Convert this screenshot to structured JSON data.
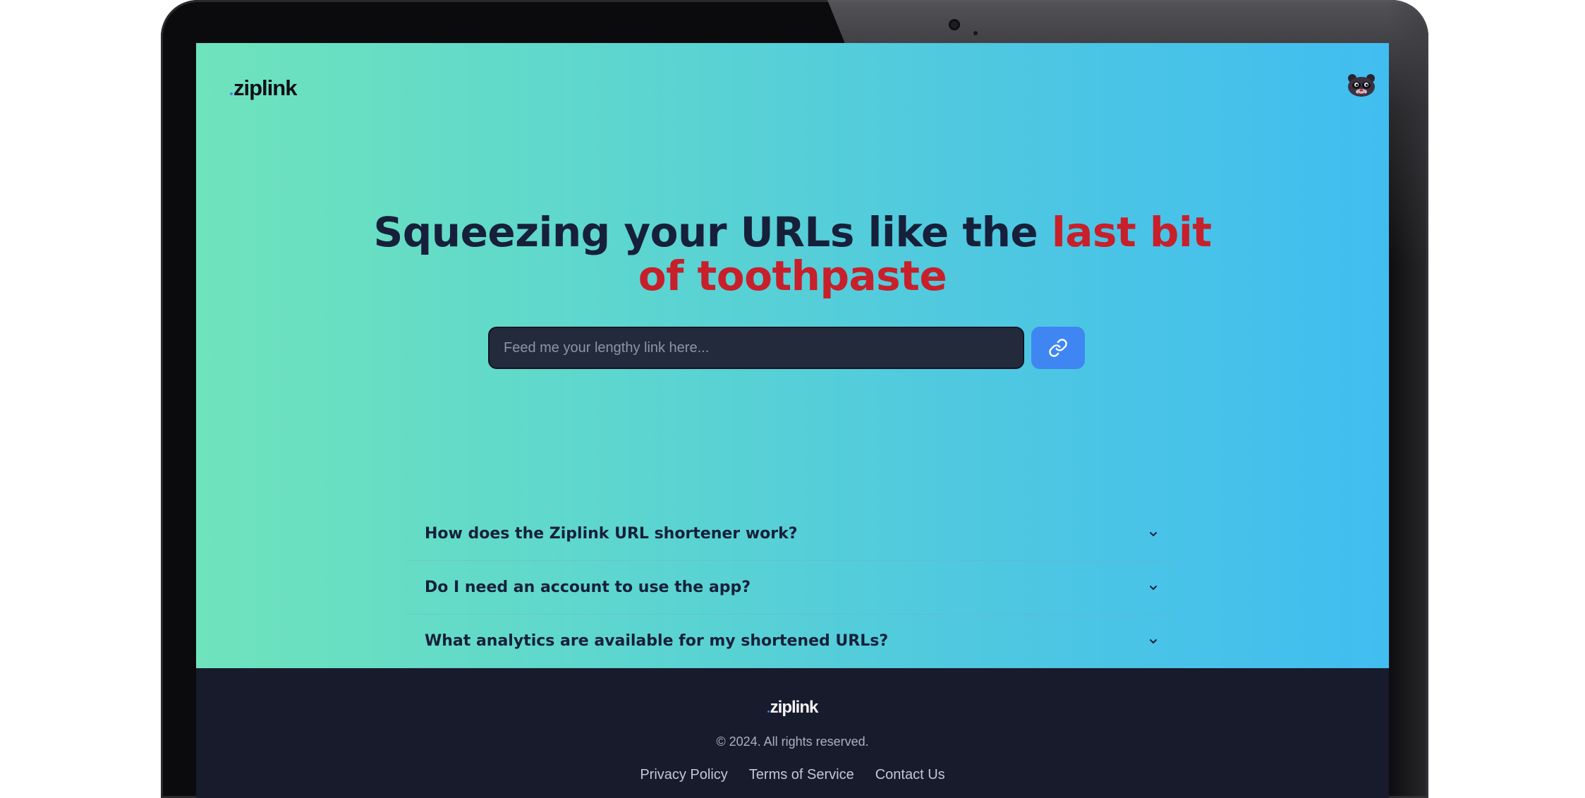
{
  "header": {
    "logo_text": "ziplink",
    "avatar_icon": "raccoon-avatar-icon"
  },
  "hero": {
    "headline_plain": "Squeezing your URLs like the ",
    "headline_accent_line1": "last bit",
    "headline_accent_line2": "of toothpaste",
    "accent_color": "#c7202b"
  },
  "shortener": {
    "input_value": "",
    "placeholder": "Feed me your lengthy link here...",
    "button_icon": "link-icon",
    "button_color": "#3f86f3"
  },
  "faq": {
    "items": [
      {
        "question": "How does the Ziplink URL shortener work?",
        "icon": "chevron-down-icon"
      },
      {
        "question": "Do I need an account to use the app?",
        "icon": "chevron-down-icon"
      },
      {
        "question": "What analytics are available for my shortened URLs?",
        "icon": "chevron-down-icon"
      }
    ]
  },
  "footer": {
    "logo_text": "ziplink",
    "copyright": "© 2024. All rights reserved.",
    "links": [
      "Privacy Policy",
      "Terms of Service",
      "Contact Us"
    ]
  },
  "colors": {
    "gradient_start": "#6fe3bb",
    "gradient_end": "#41bdf0",
    "footer_bg": "#171b2c",
    "headline_text": "#17203a"
  }
}
